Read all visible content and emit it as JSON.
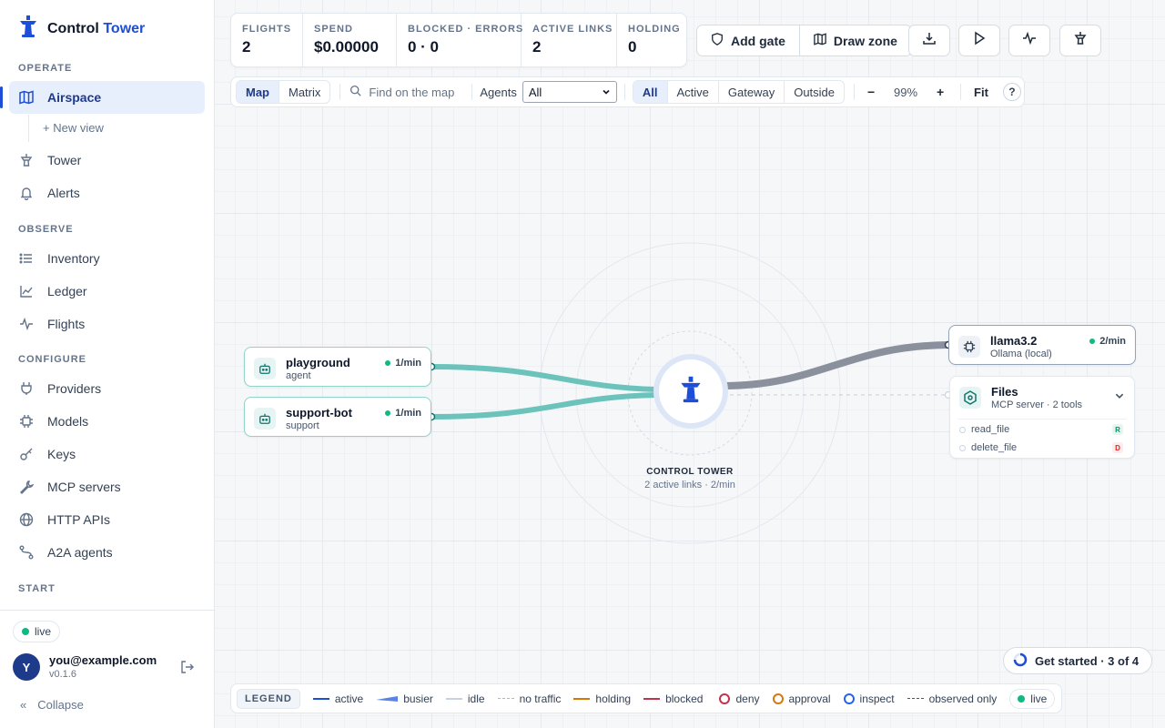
{
  "brand": {
    "name": "Control",
    "accent": "Tower"
  },
  "nav": {
    "operate_label": "OPERATE",
    "observe_label": "OBSERVE",
    "configure_label": "CONFIGURE",
    "start_label": "START",
    "airspace": "Airspace",
    "new_view": "+ New view",
    "tower": "Tower",
    "alerts": "Alerts",
    "inventory": "Inventory",
    "ledger": "Ledger",
    "flights": "Flights",
    "providers": "Providers",
    "models": "Models",
    "keys": "Keys",
    "mcp_servers": "MCP servers",
    "http_apis": "HTTP APIs",
    "a2a_agents": "A2A agents"
  },
  "footer": {
    "live": "live",
    "avatar_letter": "Y",
    "email": "you@example.com",
    "version": "v0.1.6",
    "collapse": "Collapse"
  },
  "stats": [
    {
      "label": "FLIGHTS",
      "value": "2"
    },
    {
      "label": "SPEND",
      "value": "$0.00000"
    },
    {
      "label": "BLOCKED · ERRORS",
      "value": "0 · 0"
    },
    {
      "label": "ACTIVE LINKS",
      "value": "2"
    },
    {
      "label": "HOLDING",
      "value": "0"
    }
  ],
  "actions": {
    "add_gate": "Add gate",
    "draw_zone": "Draw zone"
  },
  "toolbar": {
    "map": "Map",
    "matrix": "Matrix",
    "search_placeholder": "Find on the map",
    "agents_label": "Agents",
    "agents_value": "All",
    "filters": [
      "All",
      "Active",
      "Gateway",
      "Outside"
    ],
    "zoom_out": "−",
    "zoom": "99%",
    "zoom_in": "+",
    "fit": "Fit",
    "help": "?"
  },
  "agents": [
    {
      "name": "playground",
      "kind": "agent",
      "rate": "1/min"
    },
    {
      "name": "support-bot",
      "kind": "support",
      "rate": "1/min"
    }
  ],
  "tower": {
    "label": "CONTROL TOWER",
    "sub": "2 active links · 2/min"
  },
  "model": {
    "name": "llama3.2",
    "provider": "Ollama (local)",
    "rate": "2/min"
  },
  "files": {
    "name": "Files",
    "sub": "MCP server · 2 tools",
    "tools": [
      {
        "name": "read_file",
        "badge": "R"
      },
      {
        "name": "delete_file",
        "badge": "D"
      }
    ]
  },
  "get_started": "Get started · 3 of 4",
  "legend": {
    "title": "LEGEND",
    "active": "active",
    "busier": "busier",
    "idle": "idle",
    "no_traffic": "no traffic",
    "holding": "holding",
    "blocked": "blocked",
    "deny": "deny",
    "approval": "approval",
    "inspect": "inspect",
    "observed_only": "observed only",
    "live": "live"
  },
  "colors": {
    "accent": "#1d4ed8",
    "agent_link": "#6cc3bc",
    "model_link": "#8a909c",
    "live": "#10b981",
    "holding": "#d97706",
    "blocked": "#dc2626",
    "approval": "#d97706",
    "inspect": "#2563eb"
  }
}
